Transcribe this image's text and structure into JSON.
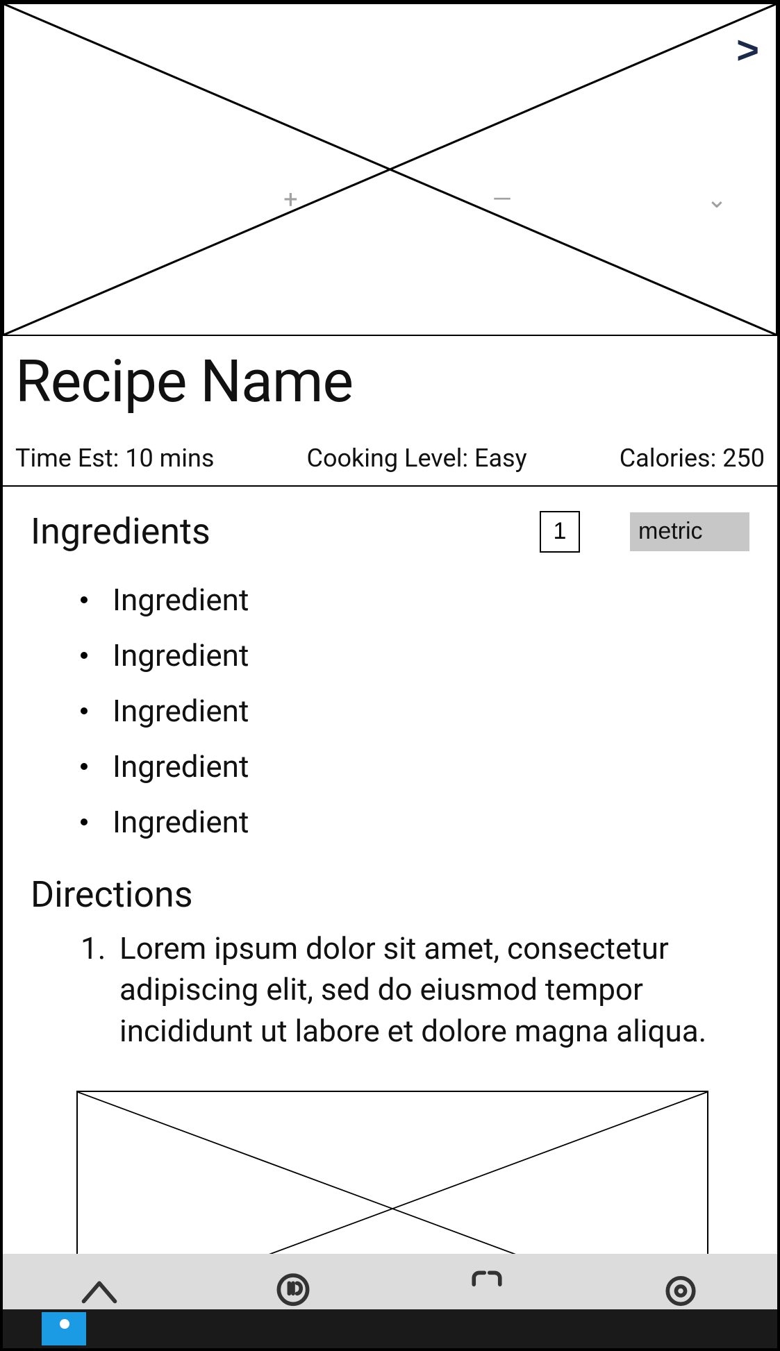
{
  "hero": {
    "next_label": ">"
  },
  "faint_controls": {
    "plus": "+",
    "minus": "—",
    "chevron": "⌄"
  },
  "title": "Recipe Name",
  "meta": {
    "time": "Time Est: 10 mins",
    "level": "Cooking Level: Easy",
    "calories": "Calories: 250"
  },
  "ingredients": {
    "heading": "Ingredients",
    "servings_value": "1",
    "unit_label": "metric",
    "items": [
      "Ingredient",
      "Ingredient",
      "Ingredient",
      "Ingredient",
      "Ingredient"
    ]
  },
  "directions": {
    "heading": "Directions",
    "steps": [
      {
        "num": "1.",
        "text": "Lorem ipsum dolor sit amet, consectetur adipiscing elit, sed do eiusmod tempor incididunt ut labore et dolore magna aliqua."
      }
    ]
  }
}
